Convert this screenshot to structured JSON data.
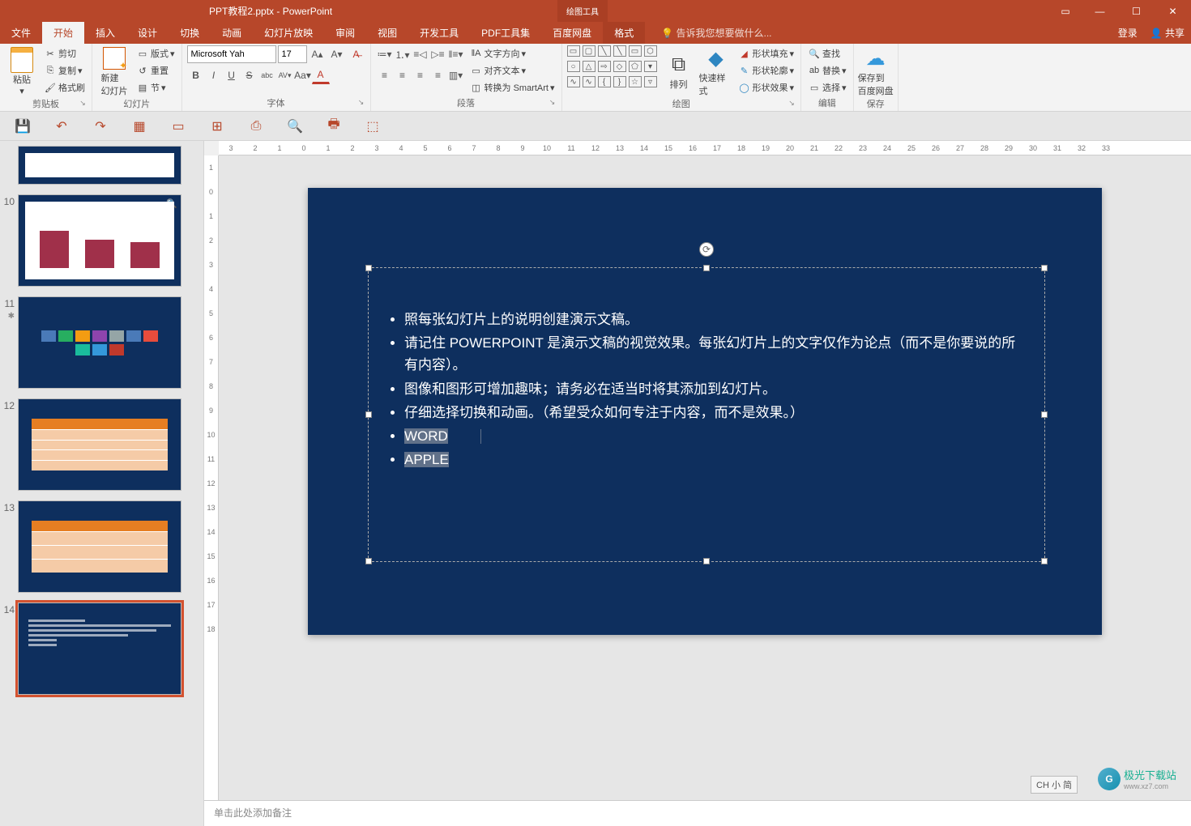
{
  "title": "PPT教程2.pptx - PowerPoint",
  "context_tool": {
    "group": "绘图工具",
    "tab": "格式"
  },
  "window_controls": {
    "ribbon_opts": "▭",
    "minimize": "—",
    "maximize": "☐",
    "close": "✕"
  },
  "tabs": [
    "文件",
    "开始",
    "插入",
    "设计",
    "切换",
    "动画",
    "幻灯片放映",
    "审阅",
    "视图",
    "开发工具",
    "PDF工具集",
    "百度网盘"
  ],
  "active_tab": "开始",
  "tell_me": {
    "icon": "💡",
    "placeholder": "告诉我您想要做什么..."
  },
  "account": {
    "login": "登录",
    "share": "共享"
  },
  "ribbon": {
    "clipboard": {
      "label": "剪贴板",
      "paste": "粘贴",
      "cut": "剪切",
      "copy": "复制",
      "format_painter": "格式刷"
    },
    "slides": {
      "label": "幻灯片",
      "new_slide": "新建\n幻灯片",
      "layout": "版式",
      "reset": "重置",
      "section": "节"
    },
    "font": {
      "label": "字体",
      "name": "Microsoft Yah",
      "size": "17",
      "increase": "A▴",
      "decrease": "A▾",
      "clear": "A⃠",
      "bold": "B",
      "italic": "I",
      "underline": "U",
      "strike": "S",
      "shadow": "abc",
      "spacing": "AV",
      "case": "Aa",
      "color": "A"
    },
    "paragraph": {
      "label": "段落",
      "bullets": "•≡",
      "numbering": "1≡",
      "indent_dec": "◁≡",
      "indent_inc": "≡▷",
      "sort": "A↓",
      "align_l": "≡",
      "align_c": "≡",
      "align_r": "≡",
      "justify": "≡",
      "columns": "▥",
      "direction": "文字方向",
      "align_text": "对齐文本",
      "smartart": "转换为 SmartArt"
    },
    "drawing": {
      "label": "绘图",
      "arrange": "排列",
      "quick_styles": "快速样式",
      "shape_fill": "形状填充",
      "shape_outline": "形状轮廓",
      "shape_effects": "形状效果"
    },
    "editing": {
      "label": "编辑",
      "find": "查找",
      "replace": "替换",
      "select": "选择"
    },
    "save": {
      "label": "保存",
      "baidu": "保存到\n百度网盘"
    }
  },
  "qat": [
    "💾",
    "↶",
    "↷",
    "▦",
    "▭",
    "⊞",
    "⎙",
    "🔍",
    "🖶",
    "⬚"
  ],
  "ruler_h": [
    "3",
    "2",
    "1",
    "0",
    "1",
    "2",
    "3",
    "4",
    "5",
    "6",
    "7",
    "8",
    "9",
    "10",
    "11",
    "12",
    "13",
    "14",
    "15",
    "16",
    "17",
    "18",
    "19",
    "20",
    "21",
    "22",
    "23",
    "24",
    "25",
    "26",
    "27",
    "28",
    "29",
    "30",
    "31",
    "32",
    "33"
  ],
  "ruler_v": [
    "1",
    "0",
    "1",
    "2",
    "3",
    "4",
    "5",
    "6",
    "7",
    "8",
    "9",
    "10",
    "11",
    "12",
    "13",
    "14",
    "15",
    "16",
    "17",
    "18"
  ],
  "thumbnails": [
    {
      "num": "",
      "type": "partial-chart"
    },
    {
      "num": "10",
      "type": "chart",
      "zoom": true
    },
    {
      "num": "11",
      "type": "images",
      "star": true
    },
    {
      "num": "12",
      "type": "table"
    },
    {
      "num": "13",
      "type": "table2"
    },
    {
      "num": "14",
      "type": "text",
      "selected": true
    }
  ],
  "slide": {
    "bullets": [
      "照每张幻灯片上的说明创建演示文稿。",
      "请记住 POWERPOINT 是演示文稿的视觉效果。每张幻灯片上的文字仅作为论点（而不是你要说的所有内容）。",
      "图像和图形可增加趣味；请务必在适当时将其添加到幻灯片。",
      "仔细选择切换和动画。（希望受众如何专注于内容，而不是效果。）",
      "WORD",
      "APPLE"
    ],
    "selected_indices": [
      4,
      5
    ]
  },
  "notes_placeholder": "单击此处添加备注",
  "watermark": {
    "name": "极光下载站",
    "url": "www.xz7.com"
  },
  "ime": "CH 小 简"
}
